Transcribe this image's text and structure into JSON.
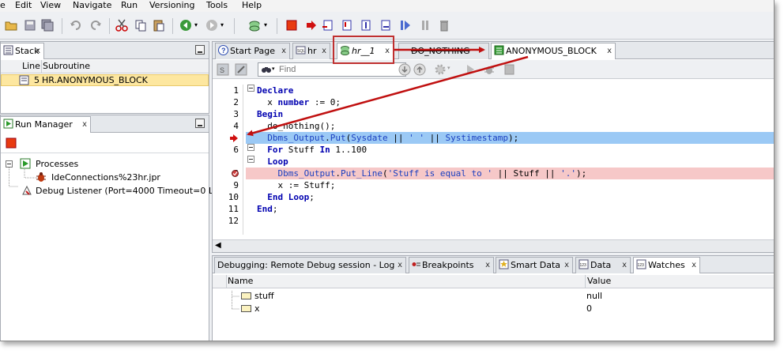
{
  "menu": [
    "e",
    "Edit",
    "View",
    "Navigate",
    "Run",
    "Versioning",
    "Tools",
    "Help"
  ],
  "stack_panel": {
    "title": "Stack",
    "columns": [
      "Line",
      "Subroutine"
    ],
    "rows": [
      {
        "line": "5",
        "subroutine": "HR.ANONYMOUS_BLOCK"
      }
    ]
  },
  "run_manager": {
    "title": "Run Manager",
    "processes_label": "Processes",
    "process_item": "IdeConnections%23hr.jpr",
    "debug_listener": "Debug Listener (Port=4000 Timeout=0 L"
  },
  "editor_tabs": [
    "Start Page",
    "hr",
    "hr__1",
    "DO_NOTHING",
    "ANONYMOUS_BLOCK"
  ],
  "find": {
    "placeholder": "Find"
  },
  "code": {
    "line_numbers": [
      "1",
      "2",
      "3",
      "4",
      "",
      "6",
      "",
      "8",
      "9",
      "10",
      "11",
      "12"
    ],
    "lines": [
      "Declare",
      "  x number := 0;",
      "Begin",
      "  do_nothing();",
      "  Dbms_Output.Put(Sysdate || ' ' || Systimestamp);",
      "  For Stuff In 1..100",
      "  Loop",
      "    Dbms_Output.Put_Line('Stuff is equal to ' || Stuff || '.');",
      "    x := Stuff;",
      "  End Loop;",
      "End;",
      ""
    ]
  },
  "bottom_tabs": [
    "Debugging: Remote Debug session - Log",
    "Breakpoints",
    "Smart Data",
    "Data",
    "Watches"
  ],
  "data_panel": {
    "columns": [
      "Name",
      "Value"
    ],
    "rows": [
      {
        "name": "stuff",
        "value": "null"
      },
      {
        "name": "x",
        "value": "0"
      }
    ]
  },
  "colors": {
    "exec_line": "#9bc9f5",
    "breakpoint_line": "#f6c8c8",
    "arrow": "#c01010",
    "highlight_box": "#c03030"
  }
}
